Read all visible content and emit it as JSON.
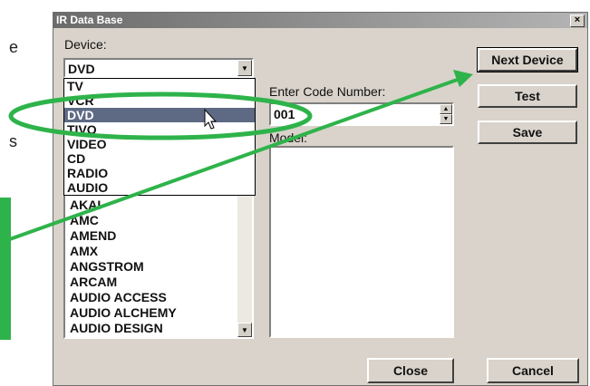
{
  "page_text": {
    "line1": "e",
    "line2": "s"
  },
  "dialog": {
    "title": "IR Data Base",
    "close_glyph": "×",
    "device_label": "Device:",
    "device_value": "DVD",
    "device_options": [
      "TV",
      "VCR",
      "DVD",
      "TIVO",
      "VIDEO",
      "CD",
      "RADIO",
      "AUDIO"
    ],
    "selected_index": 2,
    "brands": [
      "AKAI",
      "AMC",
      "AMEND",
      "AMX",
      "ANGSTROM",
      "ARCAM",
      "AUDIO ACCESS",
      "AUDIO ALCHEMY",
      "AUDIO DESIGN"
    ],
    "code_label": "Enter Code Number:",
    "code_value": "001",
    "model_label": "Model:",
    "buttons": {
      "next_device": "Next Device",
      "test": "Test",
      "save": "Save",
      "close": "Close",
      "cancel": "Cancel"
    }
  },
  "annotation": {
    "color": "#2eb34a"
  }
}
